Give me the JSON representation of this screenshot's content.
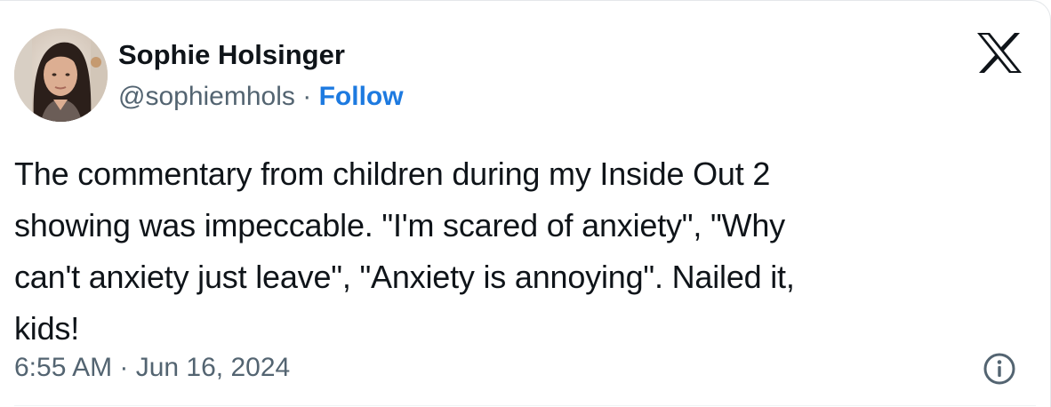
{
  "author": {
    "name": "Sophie Holsinger",
    "handle": "@sophiemhols",
    "separator": "·",
    "follow_label": "Follow"
  },
  "tweet": {
    "text": "The commentary from children during my Inside Out 2\nshowing was impeccable. \"I'm scared of anxiety\", \"Why\ncan't anxiety just leave\", \"Anxiety is annoying\". Nailed it,\nkids!"
  },
  "meta": {
    "timestamp": "6:55 AM · Jun 16, 2024"
  },
  "icons": {
    "brand": "x-logo-icon",
    "info": "info-icon",
    "avatar": "avatar"
  },
  "colors": {
    "text": "#0f1419",
    "secondary": "#536471",
    "follow": "#1d7ae0"
  }
}
